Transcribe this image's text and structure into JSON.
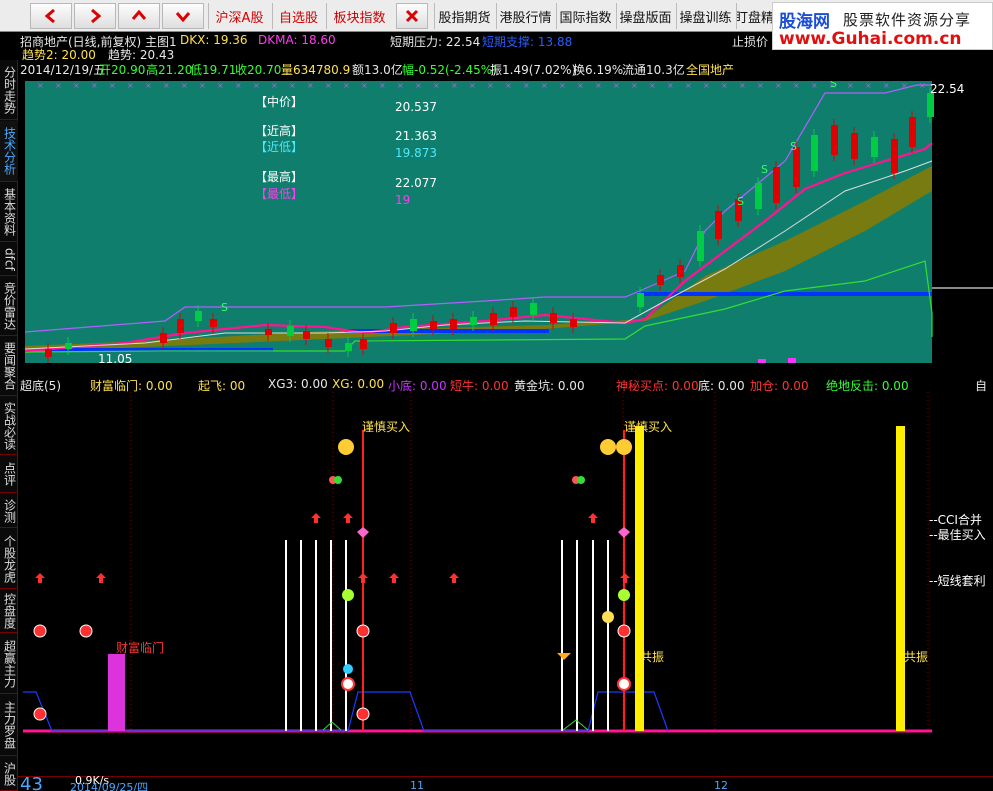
{
  "toolbar": {
    "nav": [
      {
        "name": "back-arrow-icon"
      },
      {
        "name": "forward-arrow-icon"
      },
      {
        "name": "up-arrow-icon"
      },
      {
        "name": "down-arrow-icon"
      }
    ],
    "tabs": [
      "沪深A股",
      "自选股",
      "板块指数"
    ],
    "tabs2": [
      "股指期货",
      "港股行情",
      "国际指数",
      "操盘版面",
      "操盘训练",
      "盯盘精"
    ],
    "accent_color": "#d00000"
  },
  "logo": {
    "name": "股海网",
    "slogan": "股票软件资源分享",
    "url": "www.Guhai.com.cn"
  },
  "left_tabs": [
    {
      "label": "分时走势",
      "active": false
    },
    {
      "label": "技术分析",
      "active": true
    },
    {
      "label": "基本资料",
      "active": false
    },
    {
      "label": "dfcf",
      "active": false
    },
    {
      "label": "竞价雷达",
      "active": false
    },
    {
      "label": "要闻聚合",
      "active": false
    },
    {
      "label": "实战必读",
      "active": false
    },
    {
      "label": "点评",
      "active": false
    },
    {
      "label": "诊测",
      "active": false
    },
    {
      "label": "个股龙虎",
      "active": false
    },
    {
      "label": "控盘度",
      "active": false
    },
    {
      "label": "超赢主力",
      "active": false
    },
    {
      "label": "主力罗盘",
      "active": false
    },
    {
      "label": "沪股",
      "active": false
    }
  ],
  "header": {
    "title": "招商地产(日线,前复权) 主图1",
    "dkx": "DKX: 19.36",
    "dkma": "DKMA: 18.60",
    "short_pressure": "短期压力: 22.54",
    "short_support": "短期支撑: 13.88",
    "stop_loss": "止损价",
    "trend2": "趋势2: 20.00",
    "trend": "趋势: 20.43",
    "date": "2014/12/19/五",
    "open": "开20.90",
    "high": "高21.20",
    "low": "低19.71",
    "close": "收20.70",
    "volume": "量634780.9",
    "amount": "额13.0亿",
    "change": "幅-0.52(-2.45%)",
    "amplitude": "振1.49(7.02%)",
    "turnover": "换6.19%",
    "float": "流通10.3亿",
    "sector": "全国地产"
  },
  "price_box": {
    "mid_label": "【中价】",
    "mid_value": "20.537",
    "near_high_label": "【近高】",
    "near_high_value": "21.363",
    "near_low_label": "【近低】",
    "near_low_value": "19.873",
    "top_label": "【最高】",
    "top_value": "22.077",
    "bottom_label": "【最低】",
    "bottom_value": "19"
  },
  "chart_labels": {
    "high_mark": "22.54",
    "low_mark": "11.05"
  },
  "indicator": {
    "name": "超底(5)",
    "items": [
      {
        "label": "财富临门: 0.00",
        "color": "#ffe14d"
      },
      {
        "label": "起飞: 00",
        "color": "#ffe14d"
      },
      {
        "label": "XG3: 0.00",
        "color": "#e8e8e8"
      },
      {
        "label": "XG: 0.00",
        "color": "#ffe14d"
      },
      {
        "label": "小底: 0.00",
        "color": "#cc33ff"
      },
      {
        "label": "短牛: 0.00",
        "color": "#ff3333"
      },
      {
        "label": "黄金坑: 0.00",
        "color": "#e8e8e8"
      },
      {
        "label": "神秘买点: 0.00",
        "color": "#ff3333"
      },
      {
        "label": "底: 0.00",
        "color": "#e8e8e8"
      },
      {
        "label": "加仓: 0.00",
        "color": "#ff3333"
      },
      {
        "label": "绝地反击: 0.00",
        "color": "#33ff33"
      }
    ],
    "right_mark": "自",
    "annotations": {
      "caution_buy": "谨慎买入",
      "wealth_gate": "财富临门",
      "resonance": "共振",
      "cci": "--CCI合并",
      "best_buy": "--最佳买入",
      "short_arb": "--短线套利"
    }
  },
  "status": {
    "big": "43",
    "speed": "0.9K/s",
    "date_axis": "2014/09/25/四",
    "month11": "11",
    "month12": "12"
  },
  "colors": {
    "chart_bg": "#0f7e6d",
    "up": "#e00000",
    "down": "#00cc44",
    "ma_pink": "#ff1493",
    "band": "#8a7a00",
    "support": "#0033ff"
  }
}
